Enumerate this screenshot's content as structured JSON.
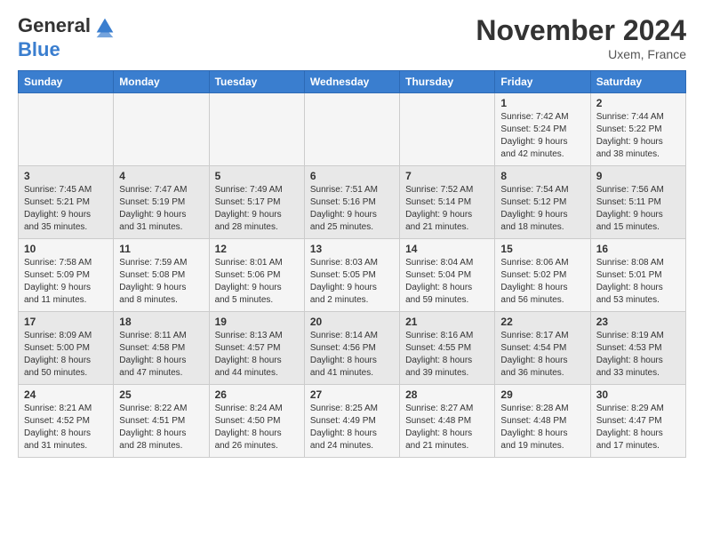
{
  "logo": {
    "line1": "General",
    "line2": "Blue"
  },
  "title": "November 2024",
  "location": "Uxem, France",
  "header_days": [
    "Sunday",
    "Monday",
    "Tuesday",
    "Wednesday",
    "Thursday",
    "Friday",
    "Saturday"
  ],
  "weeks": [
    [
      {
        "day": "",
        "info": ""
      },
      {
        "day": "",
        "info": ""
      },
      {
        "day": "",
        "info": ""
      },
      {
        "day": "",
        "info": ""
      },
      {
        "day": "",
        "info": ""
      },
      {
        "day": "1",
        "info": "Sunrise: 7:42 AM\nSunset: 5:24 PM\nDaylight: 9 hours\nand 42 minutes."
      },
      {
        "day": "2",
        "info": "Sunrise: 7:44 AM\nSunset: 5:22 PM\nDaylight: 9 hours\nand 38 minutes."
      }
    ],
    [
      {
        "day": "3",
        "info": "Sunrise: 7:45 AM\nSunset: 5:21 PM\nDaylight: 9 hours\nand 35 minutes."
      },
      {
        "day": "4",
        "info": "Sunrise: 7:47 AM\nSunset: 5:19 PM\nDaylight: 9 hours\nand 31 minutes."
      },
      {
        "day": "5",
        "info": "Sunrise: 7:49 AM\nSunset: 5:17 PM\nDaylight: 9 hours\nand 28 minutes."
      },
      {
        "day": "6",
        "info": "Sunrise: 7:51 AM\nSunset: 5:16 PM\nDaylight: 9 hours\nand 25 minutes."
      },
      {
        "day": "7",
        "info": "Sunrise: 7:52 AM\nSunset: 5:14 PM\nDaylight: 9 hours\nand 21 minutes."
      },
      {
        "day": "8",
        "info": "Sunrise: 7:54 AM\nSunset: 5:12 PM\nDaylight: 9 hours\nand 18 minutes."
      },
      {
        "day": "9",
        "info": "Sunrise: 7:56 AM\nSunset: 5:11 PM\nDaylight: 9 hours\nand 15 minutes."
      }
    ],
    [
      {
        "day": "10",
        "info": "Sunrise: 7:58 AM\nSunset: 5:09 PM\nDaylight: 9 hours\nand 11 minutes."
      },
      {
        "day": "11",
        "info": "Sunrise: 7:59 AM\nSunset: 5:08 PM\nDaylight: 9 hours\nand 8 minutes."
      },
      {
        "day": "12",
        "info": "Sunrise: 8:01 AM\nSunset: 5:06 PM\nDaylight: 9 hours\nand 5 minutes."
      },
      {
        "day": "13",
        "info": "Sunrise: 8:03 AM\nSunset: 5:05 PM\nDaylight: 9 hours\nand 2 minutes."
      },
      {
        "day": "14",
        "info": "Sunrise: 8:04 AM\nSunset: 5:04 PM\nDaylight: 8 hours\nand 59 minutes."
      },
      {
        "day": "15",
        "info": "Sunrise: 8:06 AM\nSunset: 5:02 PM\nDaylight: 8 hours\nand 56 minutes."
      },
      {
        "day": "16",
        "info": "Sunrise: 8:08 AM\nSunset: 5:01 PM\nDaylight: 8 hours\nand 53 minutes."
      }
    ],
    [
      {
        "day": "17",
        "info": "Sunrise: 8:09 AM\nSunset: 5:00 PM\nDaylight: 8 hours\nand 50 minutes."
      },
      {
        "day": "18",
        "info": "Sunrise: 8:11 AM\nSunset: 4:58 PM\nDaylight: 8 hours\nand 47 minutes."
      },
      {
        "day": "19",
        "info": "Sunrise: 8:13 AM\nSunset: 4:57 PM\nDaylight: 8 hours\nand 44 minutes."
      },
      {
        "day": "20",
        "info": "Sunrise: 8:14 AM\nSunset: 4:56 PM\nDaylight: 8 hours\nand 41 minutes."
      },
      {
        "day": "21",
        "info": "Sunrise: 8:16 AM\nSunset: 4:55 PM\nDaylight: 8 hours\nand 39 minutes."
      },
      {
        "day": "22",
        "info": "Sunrise: 8:17 AM\nSunset: 4:54 PM\nDaylight: 8 hours\nand 36 minutes."
      },
      {
        "day": "23",
        "info": "Sunrise: 8:19 AM\nSunset: 4:53 PM\nDaylight: 8 hours\nand 33 minutes."
      }
    ],
    [
      {
        "day": "24",
        "info": "Sunrise: 8:21 AM\nSunset: 4:52 PM\nDaylight: 8 hours\nand 31 minutes."
      },
      {
        "day": "25",
        "info": "Sunrise: 8:22 AM\nSunset: 4:51 PM\nDaylight: 8 hours\nand 28 minutes."
      },
      {
        "day": "26",
        "info": "Sunrise: 8:24 AM\nSunset: 4:50 PM\nDaylight: 8 hours\nand 26 minutes."
      },
      {
        "day": "27",
        "info": "Sunrise: 8:25 AM\nSunset: 4:49 PM\nDaylight: 8 hours\nand 24 minutes."
      },
      {
        "day": "28",
        "info": "Sunrise: 8:27 AM\nSunset: 4:48 PM\nDaylight: 8 hours\nand 21 minutes."
      },
      {
        "day": "29",
        "info": "Sunrise: 8:28 AM\nSunset: 4:48 PM\nDaylight: 8 hours\nand 19 minutes."
      },
      {
        "day": "30",
        "info": "Sunrise: 8:29 AM\nSunset: 4:47 PM\nDaylight: 8 hours\nand 17 minutes."
      }
    ]
  ]
}
